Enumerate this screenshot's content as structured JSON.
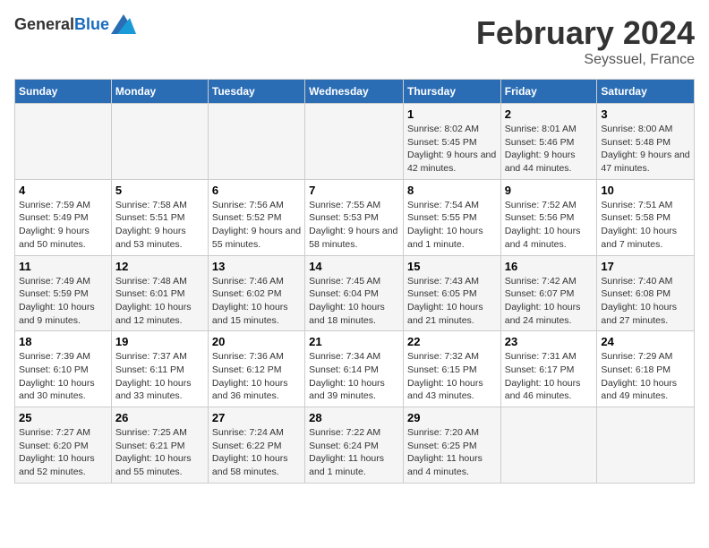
{
  "header": {
    "logo_general": "General",
    "logo_blue": "Blue",
    "title": "February 2024",
    "subtitle": "Seyssuel, France"
  },
  "columns": [
    "Sunday",
    "Monday",
    "Tuesday",
    "Wednesday",
    "Thursday",
    "Friday",
    "Saturday"
  ],
  "weeks": [
    [
      {
        "day": "",
        "detail": ""
      },
      {
        "day": "",
        "detail": ""
      },
      {
        "day": "",
        "detail": ""
      },
      {
        "day": "",
        "detail": ""
      },
      {
        "day": "1",
        "detail": "Sunrise: 8:02 AM\nSunset: 5:45 PM\nDaylight: 9 hours and 42 minutes."
      },
      {
        "day": "2",
        "detail": "Sunrise: 8:01 AM\nSunset: 5:46 PM\nDaylight: 9 hours and 44 minutes."
      },
      {
        "day": "3",
        "detail": "Sunrise: 8:00 AM\nSunset: 5:48 PM\nDaylight: 9 hours and 47 minutes."
      }
    ],
    [
      {
        "day": "4",
        "detail": "Sunrise: 7:59 AM\nSunset: 5:49 PM\nDaylight: 9 hours and 50 minutes."
      },
      {
        "day": "5",
        "detail": "Sunrise: 7:58 AM\nSunset: 5:51 PM\nDaylight: 9 hours and 53 minutes."
      },
      {
        "day": "6",
        "detail": "Sunrise: 7:56 AM\nSunset: 5:52 PM\nDaylight: 9 hours and 55 minutes."
      },
      {
        "day": "7",
        "detail": "Sunrise: 7:55 AM\nSunset: 5:53 PM\nDaylight: 9 hours and 58 minutes."
      },
      {
        "day": "8",
        "detail": "Sunrise: 7:54 AM\nSunset: 5:55 PM\nDaylight: 10 hours and 1 minute."
      },
      {
        "day": "9",
        "detail": "Sunrise: 7:52 AM\nSunset: 5:56 PM\nDaylight: 10 hours and 4 minutes."
      },
      {
        "day": "10",
        "detail": "Sunrise: 7:51 AM\nSunset: 5:58 PM\nDaylight: 10 hours and 7 minutes."
      }
    ],
    [
      {
        "day": "11",
        "detail": "Sunrise: 7:49 AM\nSunset: 5:59 PM\nDaylight: 10 hours and 9 minutes."
      },
      {
        "day": "12",
        "detail": "Sunrise: 7:48 AM\nSunset: 6:01 PM\nDaylight: 10 hours and 12 minutes."
      },
      {
        "day": "13",
        "detail": "Sunrise: 7:46 AM\nSunset: 6:02 PM\nDaylight: 10 hours and 15 minutes."
      },
      {
        "day": "14",
        "detail": "Sunrise: 7:45 AM\nSunset: 6:04 PM\nDaylight: 10 hours and 18 minutes."
      },
      {
        "day": "15",
        "detail": "Sunrise: 7:43 AM\nSunset: 6:05 PM\nDaylight: 10 hours and 21 minutes."
      },
      {
        "day": "16",
        "detail": "Sunrise: 7:42 AM\nSunset: 6:07 PM\nDaylight: 10 hours and 24 minutes."
      },
      {
        "day": "17",
        "detail": "Sunrise: 7:40 AM\nSunset: 6:08 PM\nDaylight: 10 hours and 27 minutes."
      }
    ],
    [
      {
        "day": "18",
        "detail": "Sunrise: 7:39 AM\nSunset: 6:10 PM\nDaylight: 10 hours and 30 minutes."
      },
      {
        "day": "19",
        "detail": "Sunrise: 7:37 AM\nSunset: 6:11 PM\nDaylight: 10 hours and 33 minutes."
      },
      {
        "day": "20",
        "detail": "Sunrise: 7:36 AM\nSunset: 6:12 PM\nDaylight: 10 hours and 36 minutes."
      },
      {
        "day": "21",
        "detail": "Sunrise: 7:34 AM\nSunset: 6:14 PM\nDaylight: 10 hours and 39 minutes."
      },
      {
        "day": "22",
        "detail": "Sunrise: 7:32 AM\nSunset: 6:15 PM\nDaylight: 10 hours and 43 minutes."
      },
      {
        "day": "23",
        "detail": "Sunrise: 7:31 AM\nSunset: 6:17 PM\nDaylight: 10 hours and 46 minutes."
      },
      {
        "day": "24",
        "detail": "Sunrise: 7:29 AM\nSunset: 6:18 PM\nDaylight: 10 hours and 49 minutes."
      }
    ],
    [
      {
        "day": "25",
        "detail": "Sunrise: 7:27 AM\nSunset: 6:20 PM\nDaylight: 10 hours and 52 minutes."
      },
      {
        "day": "26",
        "detail": "Sunrise: 7:25 AM\nSunset: 6:21 PM\nDaylight: 10 hours and 55 minutes."
      },
      {
        "day": "27",
        "detail": "Sunrise: 7:24 AM\nSunset: 6:22 PM\nDaylight: 10 hours and 58 minutes."
      },
      {
        "day": "28",
        "detail": "Sunrise: 7:22 AM\nSunset: 6:24 PM\nDaylight: 11 hours and 1 minute."
      },
      {
        "day": "29",
        "detail": "Sunrise: 7:20 AM\nSunset: 6:25 PM\nDaylight: 11 hours and 4 minutes."
      },
      {
        "day": "",
        "detail": ""
      },
      {
        "day": "",
        "detail": ""
      }
    ]
  ]
}
